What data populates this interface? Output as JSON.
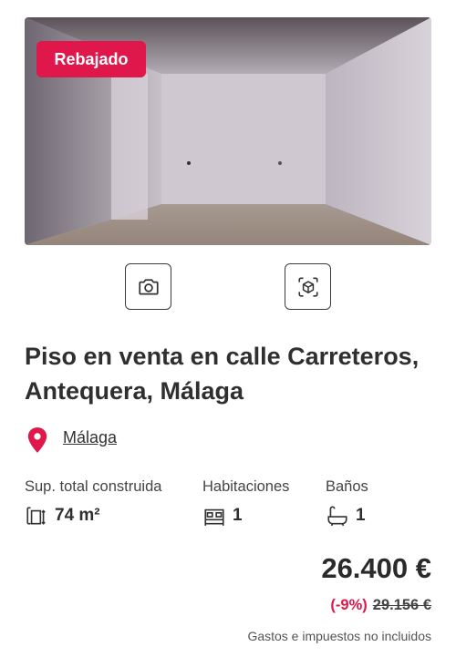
{
  "listing": {
    "badge": "Rebajado",
    "title": "Piso en venta en calle Carreteros, Antequera, Málaga",
    "location": "Málaga",
    "features": {
      "surface_label": "Sup. total construida",
      "surface_value": "74 m²",
      "rooms_label": "Habitaciones",
      "rooms_value": "1",
      "baths_label": "Baños",
      "baths_value": "1"
    },
    "price": "26.400 €",
    "discount": "(-9%)",
    "old_price": "29.156 €",
    "taxes_note": "Gastos e impuestos no incluidos"
  },
  "icons": {
    "photo_button": "camera-icon",
    "virtual_tour_button": "3d-cube-icon",
    "location": "map-pin-icon",
    "surface": "area-icon",
    "rooms": "bed-icon",
    "baths": "bathtub-icon"
  },
  "colors": {
    "accent": "#e0174a",
    "text": "#2b2b2b"
  }
}
